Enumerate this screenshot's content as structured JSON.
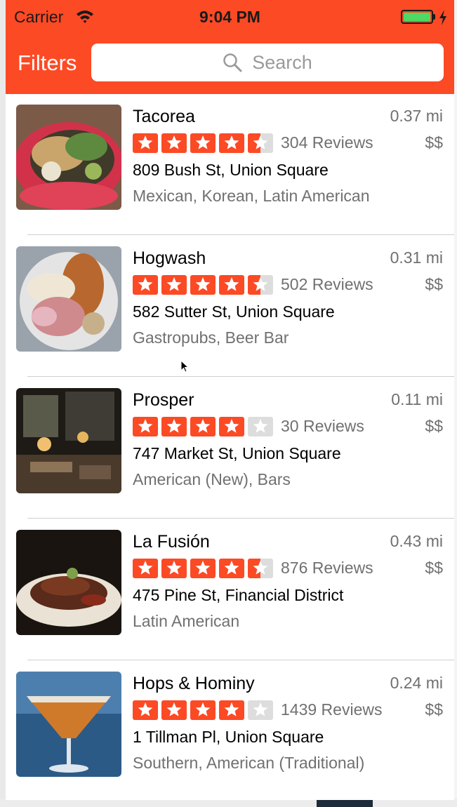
{
  "status_bar": {
    "carrier": "Carrier",
    "time": "9:04 PM"
  },
  "nav": {
    "filters_label": "Filters",
    "search_placeholder": "Search"
  },
  "colors": {
    "accent": "#fc4a25",
    "star_empty": "#dddddd",
    "secondary_text": "#707070"
  },
  "businesses": [
    {
      "name": "Tacorea",
      "distance": "0.37 mi",
      "rating": 4.5,
      "reviews": "304 Reviews",
      "price": "$$",
      "address": "809 Bush St, Union Square",
      "categories": "Mexican, Korean, Latin American"
    },
    {
      "name": "Hogwash",
      "distance": "0.31 mi",
      "rating": 4.5,
      "reviews": "502 Reviews",
      "price": "$$",
      "address": "582 Sutter St, Union Square",
      "categories": "Gastropubs, Beer Bar"
    },
    {
      "name": "Prosper",
      "distance": "0.11 mi",
      "rating": 4,
      "reviews": "30 Reviews",
      "price": "$$",
      "address": "747 Market St, Union Square",
      "categories": "American (New), Bars"
    },
    {
      "name": "La Fusión",
      "distance": "0.43 mi",
      "rating": 4.5,
      "reviews": "876 Reviews",
      "price": "$$",
      "address": "475 Pine St, Financial District",
      "categories": "Latin American"
    },
    {
      "name": "Hops & Hominy",
      "distance": "0.24 mi",
      "rating": 4,
      "reviews": "1439 Reviews",
      "price": "$$",
      "address": "1 Tillman Pl, Union Square",
      "categories": "Southern, American (Traditional)"
    }
  ]
}
